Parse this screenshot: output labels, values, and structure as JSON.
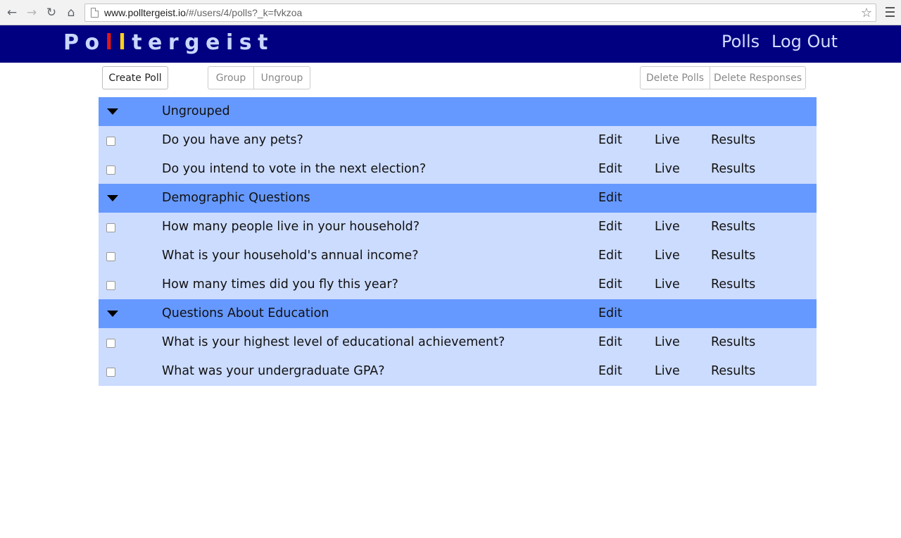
{
  "browser": {
    "url_domain": "www.polltergeist.io",
    "url_path": "/#/users/4/polls?_k=fvkzoa"
  },
  "header": {
    "logo": {
      "part1": "Po",
      "part2": "l",
      "part3": "l",
      "part4": "tergeist"
    },
    "nav": {
      "polls": "Polls",
      "logout": "Log Out"
    }
  },
  "toolbar": {
    "create_poll": "Create Poll",
    "group": "Group",
    "ungroup": "Ungroup",
    "delete_polls": "Delete Polls",
    "delete_responses": "Delete Responses"
  },
  "actions": {
    "edit": "Edit",
    "live": "Live",
    "results": "Results"
  },
  "groups": [
    {
      "name": "Ungrouped",
      "show_edit": false,
      "polls": [
        "Do you have any pets?",
        "Do you intend to vote in the next election?"
      ]
    },
    {
      "name": "Demographic Questions",
      "show_edit": true,
      "polls": [
        "How many people live in your household?",
        "What is your household's annual income?",
        "How many times did you fly this year?"
      ]
    },
    {
      "name": "Questions About Education",
      "show_edit": true,
      "polls": [
        "What is your highest level of educational achievement?",
        "What was your undergraduate GPA?"
      ]
    }
  ],
  "colors": {
    "header_bg": "#000080",
    "group_row_bg": "#6699ff",
    "poll_row_bg": "#ccdcff"
  }
}
